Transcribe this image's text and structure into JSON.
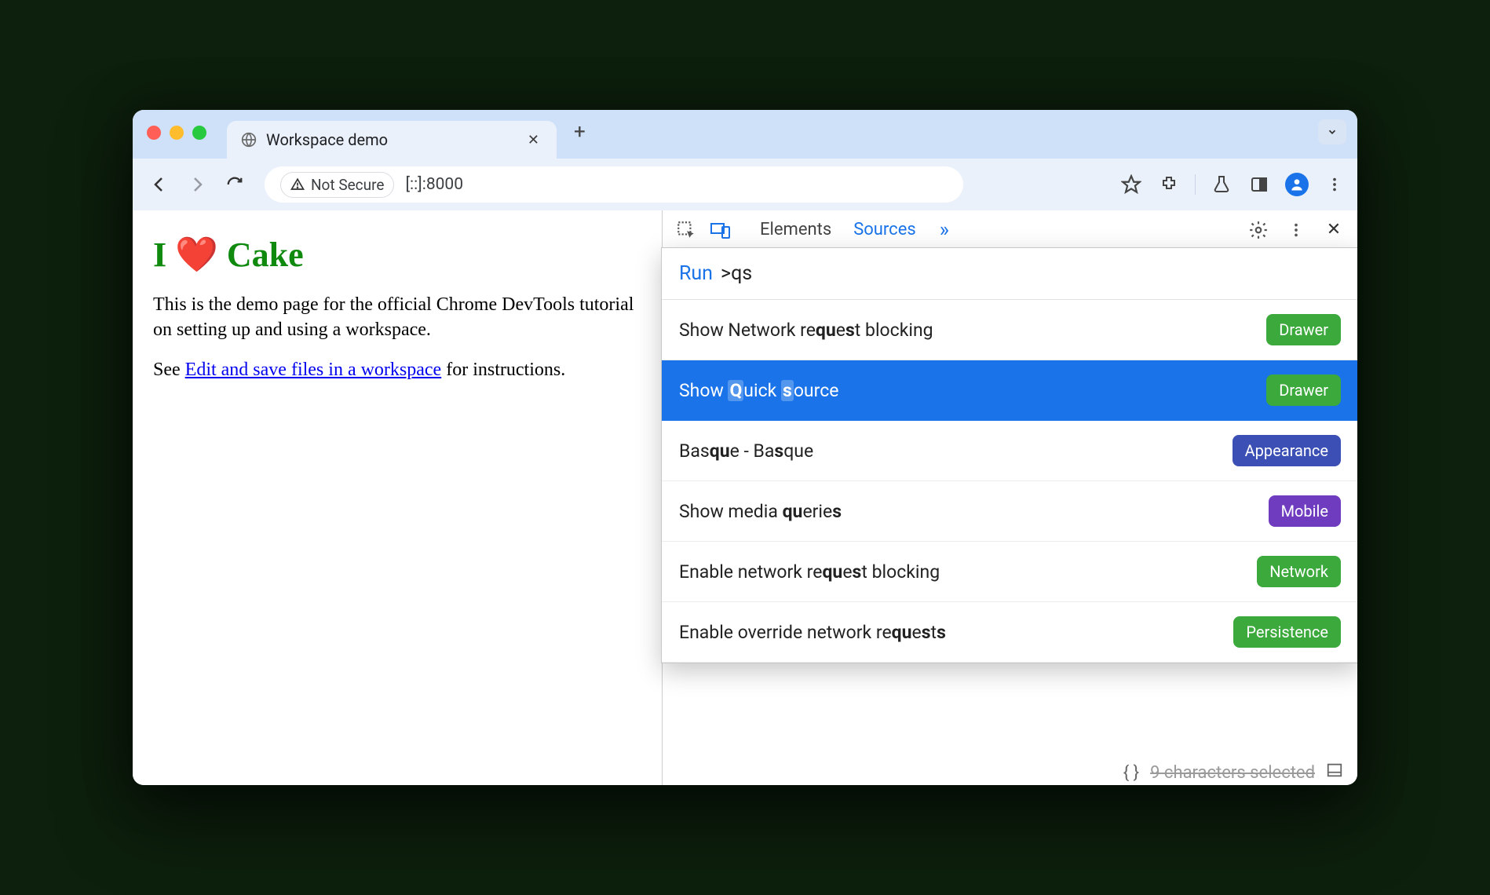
{
  "browser": {
    "tab_title": "Workspace demo",
    "not_secure": "Not Secure",
    "url": "[::]:8000"
  },
  "page": {
    "heading": "I ❤️ Cake",
    "p1": "This is the demo page for the official Chrome DevTools tutorial on setting up and using a workspace.",
    "p2_prefix": "See ",
    "p2_link": "Edit and save files in a workspace",
    "p2_suffix": " for instructions."
  },
  "devtools": {
    "tabs": {
      "elements": "Elements",
      "sources": "Sources"
    },
    "command": {
      "run_label": "Run",
      "query": ">qs",
      "items": [
        {
          "label_parts": [
            "Show Network re",
            "qu",
            "e",
            "s",
            "t blocking"
          ],
          "badge": "Drawer",
          "badge_color": "green",
          "selected": false
        },
        {
          "label_parts": [
            "Show ",
            "Q",
            "uick ",
            "s",
            "ource"
          ],
          "badge": "Drawer",
          "badge_color": "green",
          "selected": true
        },
        {
          "label_parts": [
            "Bas",
            "qu",
            "e - Ba",
            "s",
            "que"
          ],
          "badge": "Appearance",
          "badge_color": "blue",
          "selected": false
        },
        {
          "label_parts": [
            "Show media ",
            "qu",
            "erie",
            "s",
            ""
          ],
          "badge": "Mobile",
          "badge_color": "purple",
          "selected": false
        },
        {
          "label_parts": [
            "Enable network re",
            "qu",
            "e",
            "s",
            "t blocking"
          ],
          "badge": "Network",
          "badge_color": "green",
          "selected": false
        },
        {
          "label_parts": [
            "Enable override network re",
            "qu",
            "e",
            "s",
            "t",
            "s"
          ],
          "badge": "Persistence",
          "badge_color": "green",
          "selected": false
        }
      ]
    },
    "footer_text": "9 characters selected"
  }
}
